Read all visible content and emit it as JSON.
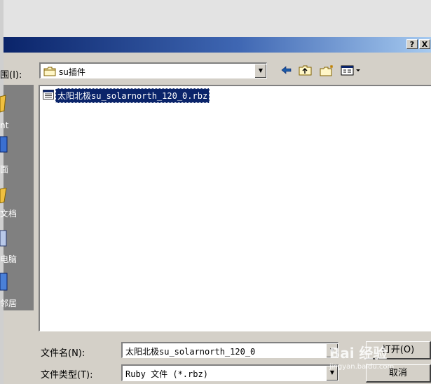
{
  "titlebar": {
    "help_label": "?",
    "close_label": "X"
  },
  "lookin": {
    "label": "围(I):",
    "folder": "su插件"
  },
  "toolbar": {
    "back_icon": "back-arrow-icon",
    "up_icon": "folder-up-icon",
    "new_folder_icon": "new-folder-icon",
    "view_icon": "view-menu-icon"
  },
  "places": [
    {
      "label": "nt"
    },
    {
      "label": "面"
    },
    {
      "label": "文档"
    },
    {
      "label": "电脑"
    },
    {
      "label": "邻居"
    }
  ],
  "files": [
    {
      "name": "太阳北极su_solarnorth_120_0.rbz",
      "selected": true
    }
  ],
  "filename": {
    "label": "文件名(N):",
    "value": "太阳北极su_solarnorth_120_0"
  },
  "filetype": {
    "label": "文件类型(T):",
    "value": "Ruby 文件 (*.rbz)"
  },
  "buttons": {
    "open": "打开(O)",
    "cancel": "取消"
  },
  "watermark": {
    "brand": "Bai 经验",
    "url": "jingyan.baidu.com"
  }
}
